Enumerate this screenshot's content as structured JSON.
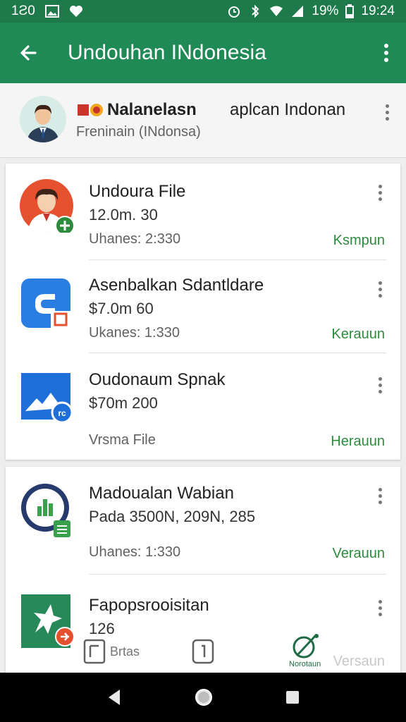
{
  "status_bar": {
    "carrier": "1Ƨ0",
    "battery": "19%",
    "time": "19:24"
  },
  "app_bar": {
    "title": "Undouhan INdonesia",
    "back_icon": "arrow-back-icon",
    "more_icon": "more-vert-icon"
  },
  "profile": {
    "name": "Nalanelasn",
    "subtitle": "aplcan Indonan",
    "description": "Freninain (INdonsa)"
  },
  "card1": [
    {
      "name": "Undoura File",
      "price": "12.0m. 30",
      "meta": "Uhanes: 2:330",
      "action": "Ksmpun",
      "icon": "person-avatar-icon"
    },
    {
      "name": "Asenbalkan Sdantldare",
      "price": "$7.0m 60",
      "meta": "Ukanes: 1:330",
      "action": "Kerauun",
      "icon": "blue-app-icon"
    },
    {
      "name": "Oudonaum Spnak",
      "price": "$70m 200",
      "meta": "Vrsma File",
      "action": "Herauun",
      "icon": "mountain-icon"
    }
  ],
  "card2": [
    {
      "name": "Madoualan Wabian",
      "price": "Pada 3500N, 209N, 285",
      "meta": "Uhanes: 1:330",
      "action": "Verauun",
      "icon": "chart-icon"
    },
    {
      "name": "Fapopsrooisitan",
      "price": "126",
      "meta": "",
      "action": "Versaun",
      "icon": "star-icon"
    }
  ],
  "bottom_tabs": [
    {
      "label": "Brtas",
      "icon": "tab-home-icon"
    },
    {
      "label": "",
      "icon": "tab-box-icon"
    },
    {
      "label": "Norotaun",
      "icon": "tab-compass-icon"
    }
  ],
  "colors": {
    "primary": "#1f8a55",
    "status": "#1e7a4b",
    "action": "#2e8b3e"
  }
}
